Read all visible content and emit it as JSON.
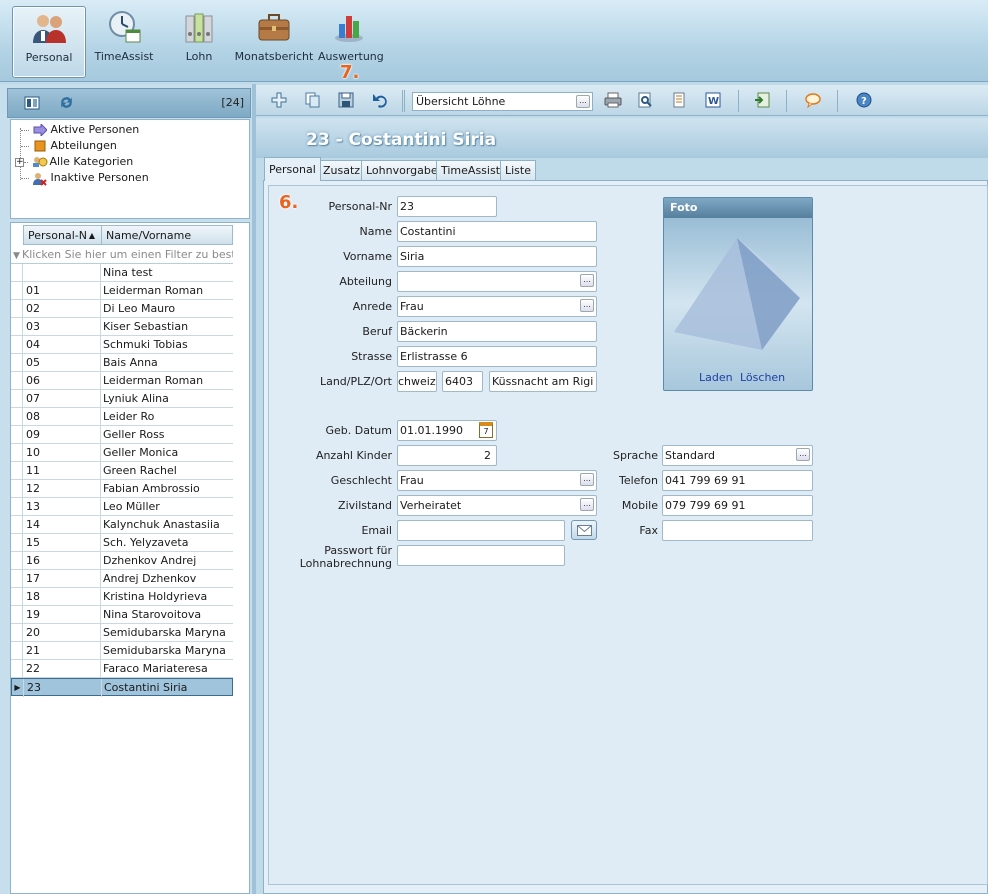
{
  "ribbon": {
    "modules": [
      {
        "label": "Personal",
        "icon": "personal-icon",
        "selected": true
      },
      {
        "label": "TimeAssist",
        "icon": "clock-icon"
      },
      {
        "label": "Lohn",
        "icon": "binders-icon"
      },
      {
        "label": "Monatsbericht",
        "icon": "briefcase-icon"
      },
      {
        "label": "Auswertung",
        "icon": "bar-chart-icon"
      }
    ],
    "callout_7": "7.",
    "callout_6": "6."
  },
  "left": {
    "count": "[24]",
    "tree": [
      {
        "label": "Aktive Personen",
        "icon": "arrow-right-icon"
      },
      {
        "label": "Abteilungen",
        "icon": "folder-icon"
      },
      {
        "label": "Alle Kategorien",
        "icon": "categories-icon"
      },
      {
        "label": "Inaktive Personen",
        "icon": "inactive-persons-icon"
      }
    ],
    "grid": {
      "col1": "Personal-N",
      "col2": "Name/Vorname",
      "filter": "Klicken Sie hier um einen Filter zu bestimmen",
      "rows": [
        {
          "nr": "",
          "name": "Nina test"
        },
        {
          "nr": "01",
          "name": "Leiderman Roman"
        },
        {
          "nr": "02",
          "name": "Di Leo Mauro"
        },
        {
          "nr": "03",
          "name": "Kiser Sebastian"
        },
        {
          "nr": "04",
          "name": "Schmuki Tobias"
        },
        {
          "nr": "05",
          "name": "Bais Anna"
        },
        {
          "nr": "06",
          "name": "Leiderman Roman"
        },
        {
          "nr": "07",
          "name": "Lyniuk Alina"
        },
        {
          "nr": "08",
          "name": "Leider Ro"
        },
        {
          "nr": "09",
          "name": "Geller Ross"
        },
        {
          "nr": "10",
          "name": "Geller Monica"
        },
        {
          "nr": "11",
          "name": "Green Rachel"
        },
        {
          "nr": "12",
          "name": "Fabian Ambrossio"
        },
        {
          "nr": "13",
          "name": "Leo Müller"
        },
        {
          "nr": "14",
          "name": "Kalynchuk Anastasiia"
        },
        {
          "nr": "15",
          "name": "Sch. Yelyzaveta"
        },
        {
          "nr": "16",
          "name": "Dzhenkov Andrej"
        },
        {
          "nr": "17",
          "name": "Andrej Dzhenkov"
        },
        {
          "nr": "18",
          "name": "Kristina Holdyrieva"
        },
        {
          "nr": "19",
          "name": "Nina Starovoitova"
        },
        {
          "nr": "20",
          "name": "Semidubarska Maryna"
        },
        {
          "nr": "21",
          "name": "Semidubarska Maryna"
        },
        {
          "nr": "22",
          "name": "Faraco Mariateresa"
        },
        {
          "nr": "23",
          "name": "Costantini  Siria",
          "selected": true
        }
      ]
    }
  },
  "toolbar": {
    "combo_value": "Übersicht Löhne"
  },
  "main": {
    "title": "23 - Costantini  Siria",
    "tabs": [
      "Personal",
      "Zusatz",
      "Lohnvorgabe",
      "TimeAssist",
      "Liste"
    ],
    "form": {
      "personal_nr": {
        "label": "Personal-Nr",
        "value": "23"
      },
      "name": {
        "label": "Name",
        "value": "Costantini"
      },
      "vorname": {
        "label": "Vorname",
        "value": "Siria"
      },
      "abteilung": {
        "label": "Abteilung",
        "value": ""
      },
      "anrede": {
        "label": "Anrede",
        "value": "Frau"
      },
      "beruf": {
        "label": "Beruf",
        "value": "Bäckerin"
      },
      "strasse": {
        "label": "Strasse",
        "value": "Erlistrasse 6"
      },
      "ort": {
        "label": "Land/PLZ/Ort",
        "land": "chweiz",
        "plz": "6403",
        "ort": "Küssnacht am Rigi"
      },
      "geb": {
        "label": "Geb. Datum",
        "value": "01.01.1990",
        "cal_day": "7"
      },
      "kinder": {
        "label": "Anzahl Kinder",
        "value": "2"
      },
      "geschlecht": {
        "label": "Geschlecht",
        "value": "Frau"
      },
      "zivilstand": {
        "label": "Zivilstand",
        "value": "Verheiratet"
      },
      "email": {
        "label": "Email",
        "value": ""
      },
      "passwort": {
        "label_1": "Passwort für",
        "label_2": "Lohnabrechnung",
        "value": ""
      },
      "sprache": {
        "label": "Sprache",
        "value": "Standard"
      },
      "telefon": {
        "label": "Telefon",
        "value": "041 799 69 91"
      },
      "mobile": {
        "label": "Mobile",
        "value": "079 799 69 91"
      },
      "fax": {
        "label": "Fax",
        "value": ""
      }
    },
    "foto": {
      "title": "Foto",
      "load": "Laden",
      "delete": "Löschen"
    }
  }
}
